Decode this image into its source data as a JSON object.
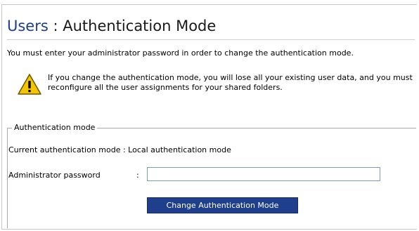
{
  "header": {
    "breadcrumb": "Users",
    "separator": " : ",
    "title": "Authentication Mode"
  },
  "intro_text": "You must enter your administrator password in order to change the authentication mode.",
  "warning": {
    "icon": "warning-triangle-icon",
    "text": "If you change the authentication mode, you will lose all your existing user data, and you must reconfigure all the user assignments for your shared folders."
  },
  "auth_section": {
    "legend": "Authentication mode",
    "current_label": "Current authentication mode",
    "current_separator": " : ",
    "current_value": "Local authentication mode",
    "password_label": "Administrator password",
    "password_separator": ":",
    "password_value": "",
    "button_label": "Change Authentication Mode"
  },
  "colors": {
    "breadcrumb": "#1d3f8a",
    "button_bg": "#1f3f8c",
    "button_text": "#ffffff",
    "warning_fill": "#f5c400"
  }
}
